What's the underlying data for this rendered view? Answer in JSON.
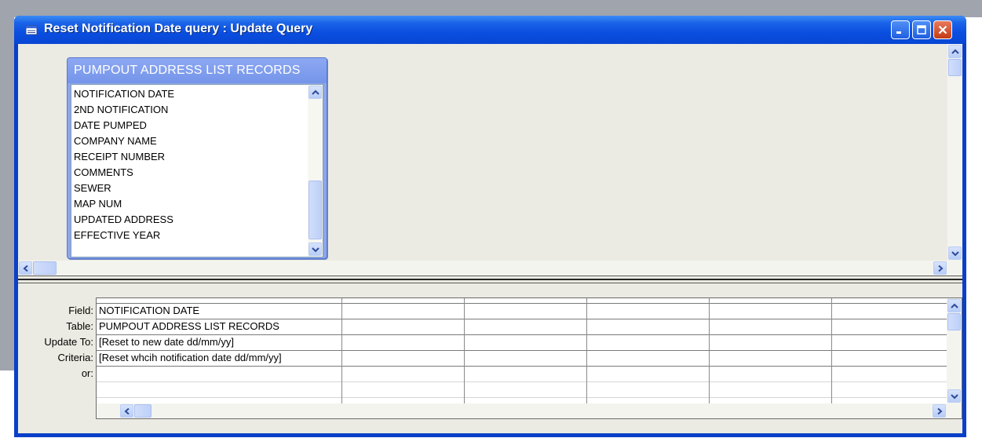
{
  "window": {
    "title": "Reset Notification Date query : Update Query"
  },
  "table_field_list": {
    "title": "PUMPOUT ADDRESS LIST RECORDS",
    "items": [
      "NOTIFICATION DATE",
      "2ND NOTIFICATION",
      "DATE PUMPED",
      "COMPANY NAME",
      "RECEIPT NUMBER",
      "COMMENTS",
      "SEWER",
      "MAP NUM",
      "UPDATED ADDRESS",
      "EFFECTIVE YEAR"
    ],
    "scroll_fraction": 0.85
  },
  "design_grid": {
    "row_labels": [
      "Field:",
      "Table:",
      "Update To:",
      "Criteria:",
      "or:"
    ],
    "columns": [
      {
        "field": "NOTIFICATION DATE",
        "table": "PUMPOUT ADDRESS LIST RECORDS",
        "update_to": "[Reset to new date dd/mm/yy]",
        "criteria": "[Reset whcih notification date dd/mm/yy]",
        "or": ""
      },
      {
        "field": "",
        "table": "",
        "update_to": "",
        "criteria": "",
        "or": ""
      },
      {
        "field": "",
        "table": "",
        "update_to": "",
        "criteria": "",
        "or": ""
      },
      {
        "field": "",
        "table": "",
        "update_to": "",
        "criteria": "",
        "or": ""
      },
      {
        "field": "",
        "table": "",
        "update_to": "",
        "criteria": "",
        "or": ""
      },
      {
        "field": "",
        "table": "",
        "update_to": "",
        "criteria": "",
        "or": ""
      }
    ]
  },
  "icons": {
    "window_icon": "query-window-icon",
    "minimize": "minimize-icon",
    "maximize": "maximize-icon",
    "close": "close-icon"
  },
  "colors": {
    "titlebar": "#0a4ee0",
    "field_list_header": "#8da8f2",
    "pane_background": "#ecebe3",
    "close_button": "#c23b16"
  }
}
